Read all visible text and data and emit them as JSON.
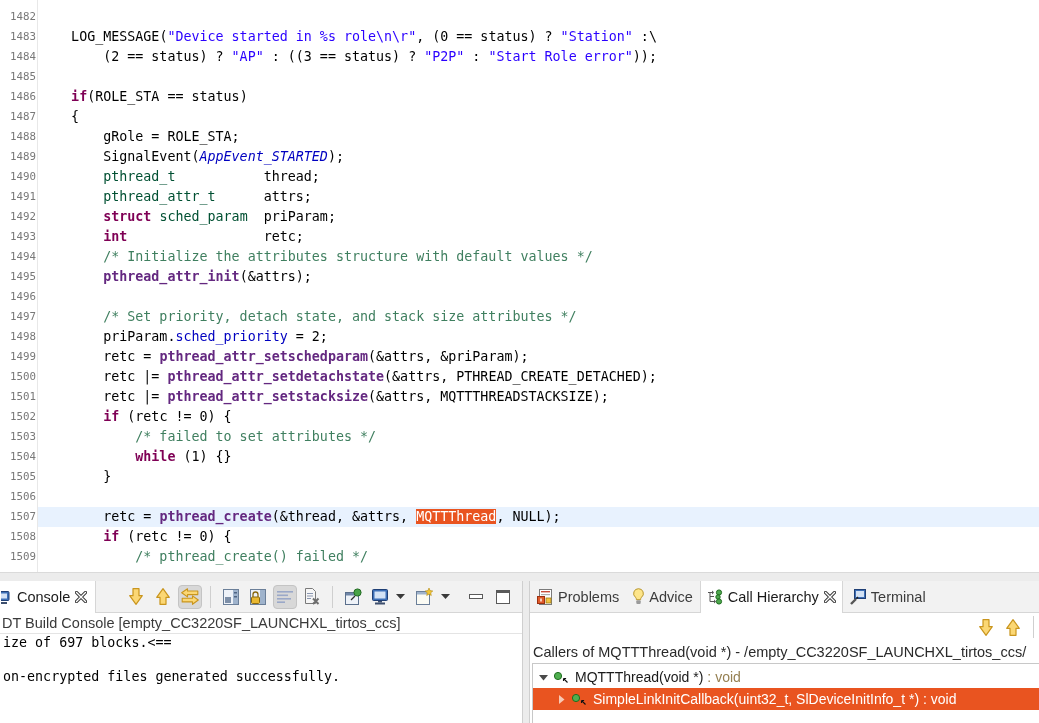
{
  "editor": {
    "lines": [
      {
        "number": "1482",
        "current": false
      },
      {
        "number": "1483",
        "current": false,
        "segments": [
          {
            "text": "    LOG_MESSAGE(",
            "kind": "plain"
          },
          {
            "text": "\"Device started in %s role\\n\\r\"",
            "kind": "string"
          },
          {
            "text": ", (0 == status) ? ",
            "kind": "plain"
          },
          {
            "text": "\"Station\"",
            "kind": "string"
          },
          {
            "text": " :\\",
            "kind": "plain"
          }
        ]
      },
      {
        "number": "1484",
        "current": false,
        "segments": [
          {
            "text": "        (2 == status) ? ",
            "kind": "plain"
          },
          {
            "text": "\"AP\"",
            "kind": "string"
          },
          {
            "text": " : ((3 == status) ? ",
            "kind": "plain"
          },
          {
            "text": "\"P2P\"",
            "kind": "string"
          },
          {
            "text": " : ",
            "kind": "plain"
          },
          {
            "text": "\"Start Role error\"",
            "kind": "string"
          },
          {
            "text": "));",
            "kind": "plain"
          }
        ]
      },
      {
        "number": "1485",
        "current": false
      },
      {
        "number": "1486",
        "current": false,
        "segments": [
          {
            "text": "    if",
            "kind": "keyword"
          },
          {
            "text": "(ROLE_STA == status)",
            "kind": "plain"
          }
        ]
      },
      {
        "number": "1487",
        "current": false,
        "segments": [
          {
            "text": "    {",
            "kind": "plain"
          }
        ]
      },
      {
        "number": "1488",
        "current": false,
        "segments": [
          {
            "text": "        gRole = ROLE_STA;",
            "kind": "plain"
          }
        ]
      },
      {
        "number": "1489",
        "current": false,
        "segments": [
          {
            "text": "        SignalEvent(",
            "kind": "plain"
          },
          {
            "text": "AppEvent_STARTED",
            "kind": "constant"
          },
          {
            "text": ");",
            "kind": "plain"
          }
        ]
      },
      {
        "number": "1490",
        "current": false,
        "segments": [
          {
            "text": "        pthread_t",
            "kind": "type"
          },
          {
            "text": "           thread;",
            "kind": "plain"
          }
        ]
      },
      {
        "number": "1491",
        "current": false,
        "segments": [
          {
            "text": "        pthread_attr_t",
            "kind": "type"
          },
          {
            "text": "      attrs;",
            "kind": "plain"
          }
        ]
      },
      {
        "number": "1492",
        "current": false,
        "segments": [
          {
            "text": "        struct",
            "kind": "keyword"
          },
          {
            "text": " sched_param",
            "kind": "type"
          },
          {
            "text": "  priParam;",
            "kind": "plain"
          }
        ]
      },
      {
        "number": "1493",
        "current": false,
        "segments": [
          {
            "text": "        int",
            "kind": "keyword"
          },
          {
            "text": "                 retc;",
            "kind": "plain"
          }
        ]
      },
      {
        "number": "1494",
        "current": false,
        "segments": [
          {
            "text": "        /* Initialize the attributes structure with default values */",
            "kind": "comment"
          }
        ]
      },
      {
        "number": "1495",
        "current": false,
        "segments": [
          {
            "text": "        pthread_attr_init",
            "kind": "function"
          },
          {
            "text": "(&attrs);",
            "kind": "plain"
          }
        ]
      },
      {
        "number": "1496",
        "current": false
      },
      {
        "number": "1497",
        "current": false,
        "segments": [
          {
            "text": "        /* Set priority, detach state, and stack size attributes */",
            "kind": "comment"
          }
        ]
      },
      {
        "number": "1498",
        "current": false,
        "segments": [
          {
            "text": "        priParam.",
            "kind": "plain"
          },
          {
            "text": "sched_priority",
            "kind": "field"
          },
          {
            "text": " = 2;",
            "kind": "plain"
          }
        ]
      },
      {
        "number": "1499",
        "current": false,
        "segments": [
          {
            "text": "        retc = ",
            "kind": "plain"
          },
          {
            "text": "pthread_attr_setschedparam",
            "kind": "function"
          },
          {
            "text": "(&attrs, &priParam);",
            "kind": "plain"
          }
        ]
      },
      {
        "number": "1500",
        "current": false,
        "segments": [
          {
            "text": "        retc |= ",
            "kind": "plain"
          },
          {
            "text": "pthread_attr_setdetachstate",
            "kind": "function"
          },
          {
            "text": "(&attrs, PTHREAD_CREATE_DETACHED);",
            "kind": "plain"
          }
        ]
      },
      {
        "number": "1501",
        "current": false,
        "segments": [
          {
            "text": "        retc |= ",
            "kind": "plain"
          },
          {
            "text": "pthread_attr_setstacksize",
            "kind": "function"
          },
          {
            "text": "(&attrs, MQTTTHREADSTACKSIZE);",
            "kind": "plain"
          }
        ]
      },
      {
        "number": "1502",
        "current": false,
        "segments": [
          {
            "text": "        if",
            "kind": "keyword"
          },
          {
            "text": " (retc != 0) {",
            "kind": "plain"
          }
        ]
      },
      {
        "number": "1503",
        "current": false,
        "segments": [
          {
            "text": "            /* failed to set attributes */",
            "kind": "comment"
          }
        ]
      },
      {
        "number": "1504",
        "current": false,
        "segments": [
          {
            "text": "            while",
            "kind": "keyword"
          },
          {
            "text": " (1) {}",
            "kind": "plain"
          }
        ]
      },
      {
        "number": "1505",
        "current": false,
        "segments": [
          {
            "text": "        }",
            "kind": "plain"
          }
        ]
      },
      {
        "number": "1506",
        "current": false
      },
      {
        "number": "1507",
        "current": true,
        "segments": [
          {
            "text": "        retc = ",
            "kind": "plain"
          },
          {
            "text": "pthread_create",
            "kind": "function"
          },
          {
            "text": "(&thread, &attrs, ",
            "kind": "plain"
          },
          {
            "text": "MQTTThread",
            "kind": "occurrence"
          },
          {
            "text": ", NULL);",
            "kind": "plain"
          }
        ]
      },
      {
        "number": "1508",
        "current": false,
        "segments": [
          {
            "text": "        if",
            "kind": "keyword"
          },
          {
            "text": " (retc != 0) {",
            "kind": "plain"
          }
        ]
      },
      {
        "number": "1509",
        "current": false,
        "segments": [
          {
            "text": "            /* pthread_create() failed */",
            "kind": "comment"
          }
        ]
      }
    ]
  },
  "console": {
    "tabs": [
      {
        "label": "Console",
        "kind": "console",
        "selected": true
      }
    ],
    "toolbar": [
      {
        "buttons": [
          {
            "kind": "down",
            "pressed": false,
            "menu": false
          },
          {
            "kind": "up",
            "pressed": false,
            "menu": false
          },
          {
            "kind": "swap",
            "pressed": true,
            "menu": false
          }
        ]
      },
      {
        "buttons": [
          {
            "kind": "layout",
            "pressed": false,
            "menu": false
          },
          {
            "kind": "lock",
            "pressed": false,
            "menu": false
          },
          {
            "kind": "wrap",
            "pressed": true,
            "menu": false
          },
          {
            "kind": "clear",
            "pressed": false,
            "menu": false
          }
        ]
      },
      {
        "buttons": [
          {
            "kind": "pin",
            "pressed": false,
            "menu": false
          },
          {
            "kind": "display",
            "pressed": false,
            "menu": true
          },
          {
            "kind": "new-window",
            "pressed": false,
            "menu": true
          }
        ]
      }
    ],
    "window_controls": [
      {
        "kind": "minimize"
      },
      {
        "kind": "maximize"
      }
    ],
    "header": "DT Build Console [empty_CC3220SF_LAUNCHXL_tirtos_ccs]",
    "output": "ize of 697 blocks.<==\n\non-encrypted files generated successfully."
  },
  "call_hierarchy": {
    "tabs": [
      {
        "label": "Problems",
        "kind": "problems",
        "selected": false
      },
      {
        "label": "Advice",
        "kind": "advice",
        "selected": false
      },
      {
        "label": "Call Hierarchy",
        "kind": "hierarchy",
        "selected": true
      },
      {
        "label": "Terminal",
        "kind": "terminal",
        "selected": false
      }
    ],
    "toolbar": [
      {
        "buttons": [
          {
            "kind": "down",
            "pressed": false,
            "menu": false
          },
          {
            "kind": "up",
            "pressed": false,
            "menu": false
          }
        ]
      }
    ],
    "caption": "Callers of MQTTThread(void *) - /empty_CC3220SF_LAUNCHXL_tirtos_ccs/",
    "tree": [
      {
        "label": "MQTTThread(void *)",
        "suffix": ": void",
        "expanded": true,
        "selected": false,
        "children": [
          {
            "label": "SimpleLinkInitCallback(uint32_t, SlDeviceInitInfo_t *)",
            "suffix": ": void",
            "expanded": false,
            "selected": true
          }
        ]
      }
    ]
  }
}
